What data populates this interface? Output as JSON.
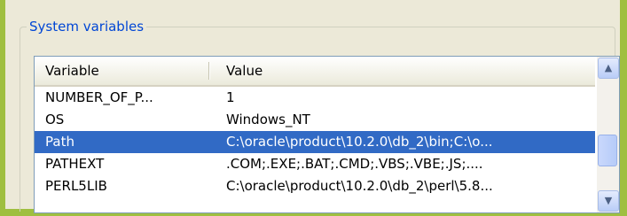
{
  "section": {
    "title": "System variables"
  },
  "list": {
    "columns": [
      "Variable",
      "Value"
    ],
    "rows": [
      {
        "variable": "NUMBER_OF_P...",
        "value": "1",
        "selected": false
      },
      {
        "variable": "OS",
        "value": "Windows_NT",
        "selected": false
      },
      {
        "variable": "Path",
        "value": "C:\\oracle\\product\\10.2.0\\db_2\\bin;C:\\o...",
        "selected": true
      },
      {
        "variable": "PATHEXT",
        "value": ".COM;.EXE;.BAT;.CMD;.VBS;.VBE;.JS;....",
        "selected": false
      },
      {
        "variable": "PERL5LIB",
        "value": "C:\\oracle\\product\\10.2.0\\db_2\\perl\\5.8...",
        "selected": false
      }
    ]
  },
  "scrollbar": {
    "up_icon": "arrow-up-icon",
    "down_icon": "arrow-down-icon"
  },
  "colors": {
    "selection": "#316ac5",
    "group_title": "#0046d5",
    "desktop": "#9fbf40"
  }
}
